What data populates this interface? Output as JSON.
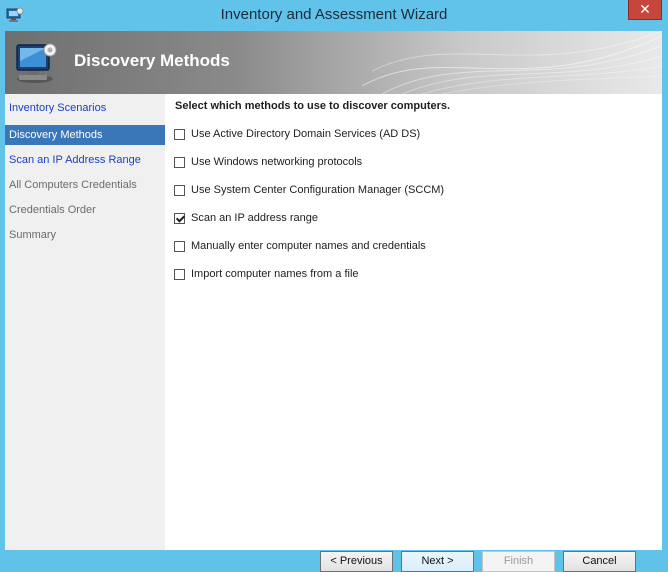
{
  "window": {
    "title": "Inventory and Assessment Wizard",
    "close_glyph": "✕"
  },
  "banner": {
    "title": "Discovery Methods",
    "icon": "computer-monitor-icon"
  },
  "sidebar": {
    "items": [
      {
        "label": "Inventory Scenarios",
        "state": "link"
      },
      {
        "label": "Discovery Methods",
        "state": "active"
      },
      {
        "label": "Scan an IP Address Range",
        "state": "link"
      },
      {
        "label": "All Computers Credentials",
        "state": "muted"
      },
      {
        "label": "Credentials Order",
        "state": "muted"
      },
      {
        "label": "Summary",
        "state": "muted"
      }
    ]
  },
  "content": {
    "heading": "Select which methods to use to discover computers.",
    "options": [
      {
        "label": "Use Active Directory Domain Services (AD DS)",
        "checked": false
      },
      {
        "label": "Use Windows networking protocols",
        "checked": false
      },
      {
        "label": "Use System Center Configuration Manager (SCCM)",
        "checked": false
      },
      {
        "label": "Scan an IP address range",
        "checked": true
      },
      {
        "label": "Manually enter computer names and credentials",
        "checked": false
      },
      {
        "label": "Import computer names from a file",
        "checked": false
      }
    ]
  },
  "buttons": {
    "previous": "< Previous",
    "next": "Next >",
    "finish": "Finish",
    "cancel": "Cancel"
  },
  "colors": {
    "accent": "#3a77b8",
    "link": "#1a3fbf",
    "frame": "#62c3ea",
    "close": "#c7463b"
  }
}
